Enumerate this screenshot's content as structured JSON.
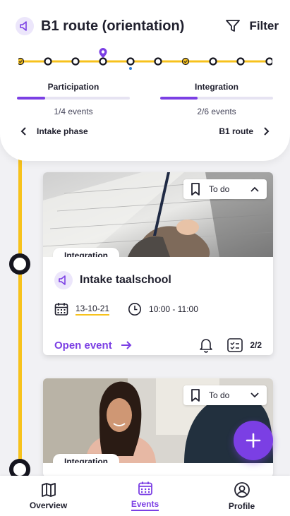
{
  "header": {
    "title": "B1 route (orientation)",
    "filter_label": "Filter",
    "icon": "speaker-icon"
  },
  "progress": {
    "participation": {
      "label": "Participation",
      "count": "1/4 events",
      "fraction": 0.25
    },
    "integration": {
      "label": "Integration",
      "count": "2/6 events",
      "fraction": 0.333
    }
  },
  "phase": {
    "previous": "Intake phase",
    "next": "B1 route"
  },
  "cards": [
    {
      "todo": "To do",
      "tag": "Integration",
      "title": "Intake taalschool",
      "date": "13-10-21",
      "time": "10:00 - 11:00",
      "open_label": "Open event",
      "checklist": "2/2"
    },
    {
      "todo": "To do",
      "tag": "Integration"
    }
  ],
  "nav": {
    "overview": "Overview",
    "events": "Events",
    "profile": "Profile"
  },
  "colors": {
    "accent": "#7b3fe4",
    "timeline": "#f7c21c",
    "dark": "#15151f"
  }
}
